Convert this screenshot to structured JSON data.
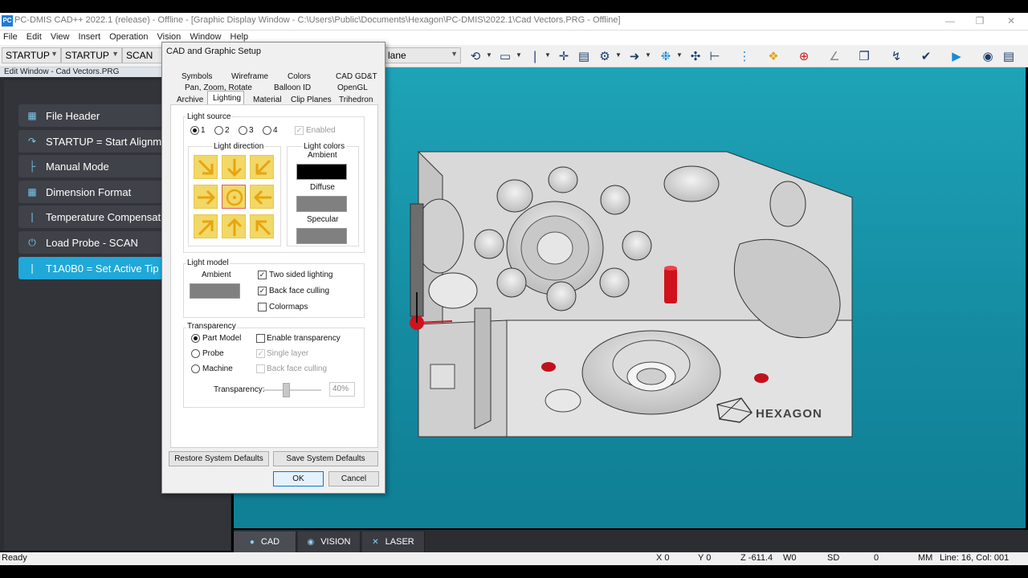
{
  "window": {
    "app_icon": "PC",
    "title": "PC-DMIS CAD++ 2022.1 (release) - Offline - [Graphic Display Window - C:\\Users\\Public\\Documents\\Hexagon\\PC-DMIS\\2022.1\\Cad Vectors.PRG - Offline]"
  },
  "menu": [
    "File",
    "Edit",
    "View",
    "Insert",
    "Operation",
    "Vision",
    "Window",
    "Help"
  ],
  "toolbar": {
    "combo1": "STARTUP",
    "combo2": "STARTUP",
    "combo3": "SCAN",
    "combo4": "lane"
  },
  "edit_window": {
    "header": "Edit Window - Cad Vectors.PRG",
    "items": [
      {
        "label": "File Header",
        "icon": "document-icon"
      },
      {
        "label": "STARTUP = Start Alignment",
        "icon": "alignment-icon"
      },
      {
        "label": "Manual Mode",
        "icon": "manual-mode-icon"
      },
      {
        "label": "Dimension Format",
        "icon": "grid-icon"
      },
      {
        "label": "Temperature Compensation",
        "icon": "thermometer-icon"
      },
      {
        "label": "Load Probe - SCAN",
        "icon": "power-icon"
      },
      {
        "label": "T1A0B0 = Set Active Tip",
        "icon": "probe-tip-icon",
        "active": true
      }
    ]
  },
  "graphics": {
    "logo_text": "HEXAGON"
  },
  "bottom_tabs": [
    {
      "label": "CAD",
      "icon": "cad-icon"
    },
    {
      "label": "VISION",
      "icon": "camera-icon"
    },
    {
      "label": "LASER",
      "icon": "laser-icon"
    }
  ],
  "status": {
    "ready": "Ready",
    "x": "X 0",
    "y": "Y 0",
    "z": "Z -611.4",
    "w": "W0",
    "sd": "SD",
    "zero": "0",
    "units": "MM",
    "line": "Line: 16, Col: 001"
  },
  "dialog": {
    "title": "CAD and Graphic Setup",
    "tabs_row1": [
      "Symbols",
      "Wireframe",
      "Colors",
      "CAD GD&T"
    ],
    "tabs_row2": [
      "Pan, Zoom, Rotate",
      "Balloon ID",
      "OpenGL"
    ],
    "tabs_row3": [
      "Archive",
      "Lighting",
      "Material",
      "Clip Planes",
      "Trihedron"
    ],
    "light_source": {
      "title": "Light source",
      "options": [
        "1",
        "2",
        "3",
        "4"
      ],
      "selected": "1",
      "enabled_label": "Enabled"
    },
    "light_direction": {
      "title": "Light direction"
    },
    "light_colors": {
      "title": "Light colors",
      "ambient": "Ambient",
      "diffuse": "Diffuse",
      "specular": "Specular",
      "ambient_color": "#000000",
      "diffuse_color": "#808080",
      "specular_color": "#808080"
    },
    "light_model": {
      "title": "Light model",
      "ambient": "Ambient",
      "ambient_color": "#808080",
      "two_sided": "Two sided lighting",
      "back_face": "Back face culling",
      "colormaps": "Colormaps"
    },
    "transparency": {
      "title": "Transparency",
      "part_model": "Part Model",
      "probe": "Probe",
      "machine": "Machine",
      "enable": "Enable transparency",
      "single_layer": "Single layer",
      "back_face": "Back face culling",
      "slider_label": "Transparency:",
      "value": "40%"
    },
    "buttons": {
      "restore": "Restore System Defaults",
      "save": "Save System Defaults",
      "ok": "OK",
      "cancel": "Cancel"
    }
  }
}
